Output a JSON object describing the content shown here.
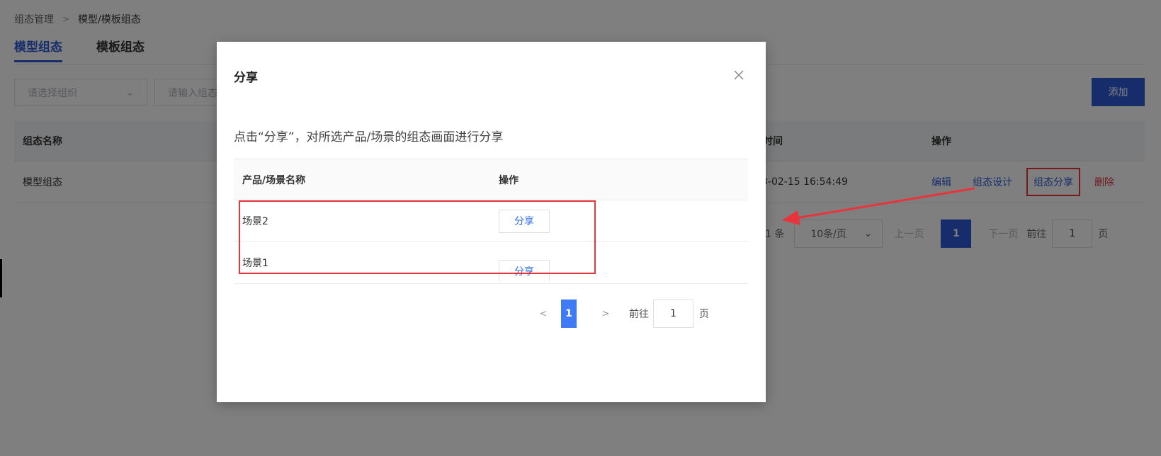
{
  "breadcrumb": {
    "parent": "组态管理",
    "current": "模型/模板组态"
  },
  "tabs": [
    {
      "label": "模型组态"
    },
    {
      "label": "模板组态"
    }
  ],
  "filters": {
    "org_placeholder": "请选择组织",
    "name_placeholder": "请输入组态"
  },
  "toolbar": {
    "add_label": "添加"
  },
  "table": {
    "headers": {
      "name": "组态名称",
      "time": "时间",
      "ops": "操作"
    },
    "row": {
      "name": "模型组态",
      "time": "3-02-15 16:54:49",
      "actions": {
        "edit": "编辑",
        "design": "组态设计",
        "share": "组态分享",
        "delete": "删除"
      }
    }
  },
  "pagination": {
    "total": "1 条",
    "page_size": "10条/页",
    "prev": "上一页",
    "current": "1",
    "next": "下一页",
    "goto_label": "前往",
    "goto_value": "1",
    "page_unit": "页"
  },
  "modal": {
    "title": "分享",
    "description": "点击“分享”，对所选产品/场景的组态画面进行分享",
    "headers": {
      "name": "产品/场景名称",
      "ops": "操作"
    },
    "rows": [
      {
        "name": "场景2",
        "button": "分享"
      },
      {
        "name": "场景1",
        "button": "分享"
      }
    ],
    "pagination": {
      "prev": "<",
      "current": "1",
      "next": ">",
      "goto_label": "前往",
      "goto_value": "1",
      "page_unit": "页"
    }
  },
  "colors": {
    "accent": "#2f5bd6",
    "highlight": "#e8343a",
    "danger": "#e0323e"
  }
}
